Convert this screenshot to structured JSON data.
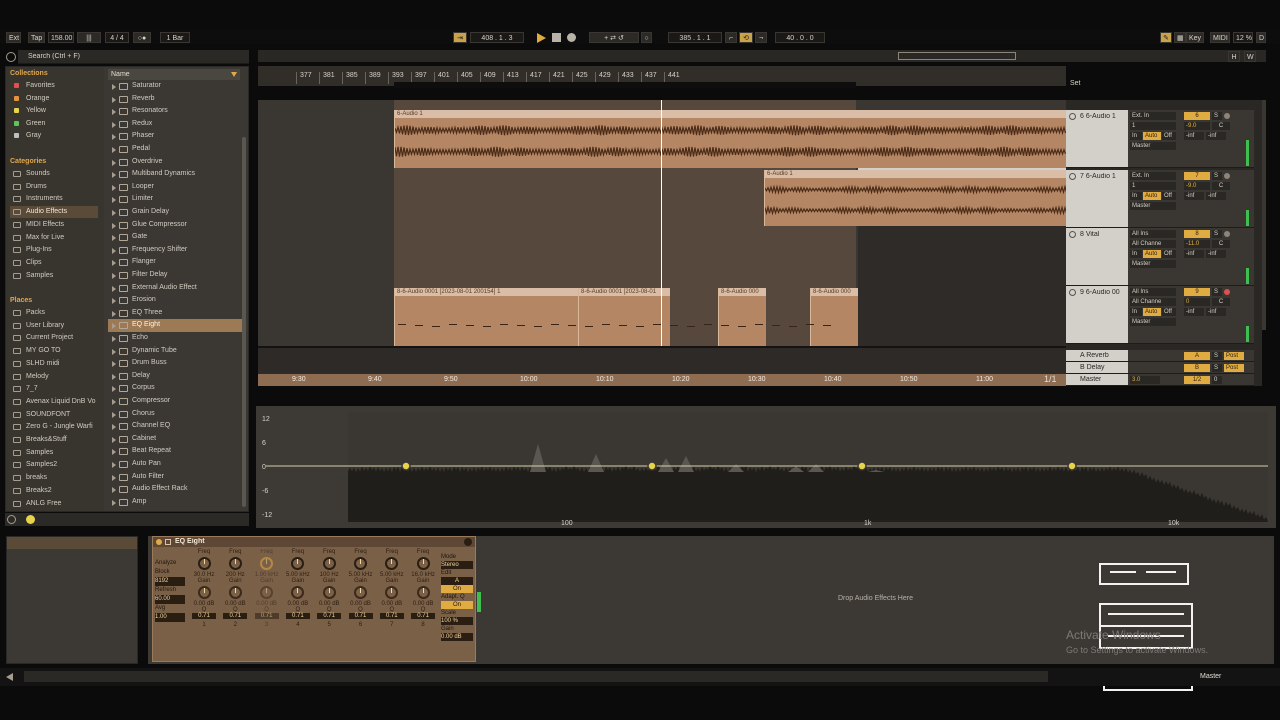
{
  "transport": {
    "ext": "Ext",
    "tap": "Tap",
    "tempo": "158.00",
    "sig": "4 / 4",
    "quant": "1 Bar",
    "pos1": "408 .  1 .  3",
    "pos2": "385 .  1 .  1",
    "len": "40 .  0 .  0",
    "key": "Key",
    "midi": "MIDI",
    "cpu": "12 %",
    "d": "D"
  },
  "browser": {
    "search_placeholder": "Search (Ctrl + F)",
    "collections_title": "Collections",
    "collections": [
      {
        "label": "Favorites",
        "color": "#e05050"
      },
      {
        "label": "Orange",
        "color": "#e8923a"
      },
      {
        "label": "Yellow",
        "color": "#e6d44a"
      },
      {
        "label": "Green",
        "color": "#5cc65c"
      },
      {
        "label": "Gray",
        "color": "#bfbfbf"
      }
    ],
    "categories_title": "Categories",
    "categories": [
      "Sounds",
      "Drums",
      "Instruments",
      "Audio Effects",
      "MIDI Effects",
      "Max for Live",
      "Plug-Ins",
      "Clips",
      "Samples"
    ],
    "places_title": "Places",
    "places": [
      "Packs",
      "User Library",
      "Current Project",
      "MY GO TO",
      "SLHD midi",
      "Melody",
      "7_7",
      "Avenax Liquid DnB Vo",
      "SOUNDFONT",
      "Zero G - Jungle Warfi",
      "Breaks&Stuff",
      "Samples",
      "Samples2",
      "breaks",
      "Breaks2",
      "ANLG Free"
    ],
    "name_header": "Name",
    "items": [
      "Saturator",
      "Reverb",
      "Resonators",
      "Redux",
      "Phaser",
      "Pedal",
      "Overdrive",
      "Multiband Dynamics",
      "Looper",
      "Limiter",
      "Grain Delay",
      "Glue Compressor",
      "Gate",
      "Frequency Shifter",
      "Flanger",
      "Filter Delay",
      "External Audio Effect",
      "Erosion",
      "EQ Three",
      "EQ Eight",
      "Echo",
      "Dynamic Tube",
      "Drum Buss",
      "Delay",
      "Corpus",
      "Compressor",
      "Chorus",
      "Channel EQ",
      "Cabinet",
      "Beat Repeat",
      "Auto Pan",
      "Auto Filter",
      "Audio Effect Rack",
      "Amp"
    ]
  },
  "ruler": {
    "bars": [
      "377",
      "381",
      "385",
      "389",
      "393",
      "397",
      "401",
      "405",
      "409",
      "413",
      "417",
      "421",
      "425",
      "429",
      "433",
      "437",
      "441"
    ],
    "times": [
      "9:30",
      "9:40",
      "9:50",
      "10:00",
      "10:10",
      "10:20",
      "10:30",
      "10:40",
      "10:50",
      "11:00"
    ],
    "set": "Set",
    "page": "1/1"
  },
  "tracks": [
    {
      "name": "6 6-Audio 1",
      "input": "Ext. In",
      "channel": "1",
      "in": "In",
      "auto": "Auto",
      "off": "Off",
      "out": "Master",
      "num": "6",
      "vol": "-9.0",
      "pan": "C",
      "a": "-inf",
      "b": "-inf",
      "s": "S"
    },
    {
      "name": "7 6-Audio 1",
      "input": "Ext. In",
      "channel": "1",
      "in": "In",
      "auto": "Auto",
      "off": "Off",
      "out": "Master",
      "num": "7",
      "vol": "-9.0",
      "pan": "C",
      "a": "-inf",
      "b": "-inf",
      "s": "S"
    },
    {
      "name": "8 Vital",
      "input": "All Ins",
      "channel": "All Channe",
      "in": "In",
      "auto": "Auto",
      "off": "Off",
      "out": "Master",
      "num": "8",
      "vol": "-11.0",
      "pan": "C",
      "a": "-inf",
      "b": "-inf",
      "s": "S"
    },
    {
      "name": "9 6-Audio 00",
      "input": "All Ins",
      "channel": "All Channe",
      "in": "In",
      "auto": "Auto",
      "off": "Off",
      "out": "Master",
      "num": "9",
      "vol": "0",
      "pan": "C",
      "a": "-inf",
      "b": "-inf",
      "s": "S"
    }
  ],
  "returns": [
    {
      "name": "A Reverb",
      "letter": "A",
      "s": "S",
      "post": "Post"
    },
    {
      "name": "B Delay",
      "letter": "B",
      "s": "S",
      "post": "Post"
    },
    {
      "name": "Master",
      "letter": "1/2",
      "vol": "3.0",
      "s": "0"
    }
  ],
  "clips": {
    "c1": "6-Audio 1",
    "c2": "6-Audio 1",
    "c3": "8-6-Audio 0001 [2023-08-01 200154] 1",
    "c4": "8-6-Audio 0001 [2023-08-01",
    "c5": "8-6-Audio 000",
    "c6": "8-6-Audio 000"
  },
  "eq": {
    "db": [
      "12",
      "6",
      "0",
      "-6",
      "-12"
    ],
    "freq": [
      "100",
      "1k",
      "10k"
    ],
    "nodes": [
      150,
      396,
      606,
      816
    ]
  },
  "device": {
    "title": "EQ Eight",
    "analyze": "Analyze",
    "block": "Block",
    "block_val": "8192",
    "refresh": "Refresh",
    "refresh_val": "60.00",
    "avg": "Avg",
    "avg_val": "1.00",
    "bands": [
      {
        "freq": "30.0 Hz",
        "gain": "0.00 dB",
        "q": "0.71",
        "n": "1"
      },
      {
        "freq": "200 Hz",
        "gain": "0.00 dB",
        "q": "0.71",
        "n": "2"
      },
      {
        "freq": "1.00 kHz",
        "gain": "0.00 dB",
        "q": "0.71",
        "n": "3"
      },
      {
        "freq": "5.00 kHz",
        "gain": "0.00 dB",
        "q": "0.71",
        "n": "4"
      },
      {
        "freq": "100 Hz",
        "gain": "0.00 dB",
        "q": "0.71",
        "n": "5"
      },
      {
        "freq": "5.00 kHz",
        "gain": "0.00 dB",
        "q": "0.71",
        "n": "6"
      },
      {
        "freq": "5.00 kHz",
        "gain": "0.00 dB",
        "q": "0.71",
        "n": "7"
      },
      {
        "freq": "16.0 kHz",
        "gain": "0.00 dB",
        "q": "0.71",
        "n": "8"
      }
    ],
    "freq_label": "Freq",
    "gain_label": "Gain",
    "q_label": "Q",
    "mode": "Mode",
    "mode_val": "Stereo",
    "edit": "Edit",
    "edit_val": "A",
    "edit_on": "On",
    "adapt": "Adapt. Q",
    "adapt_val": "On",
    "scale": "Scale",
    "scale_val": "100 %",
    "gain_out": "Gain",
    "gain_out_val": "0.00 dB"
  },
  "drop_text": "Drop Audio Effects Here",
  "watermark": {
    "line1": "Activate Windows",
    "line2": "Go to Settings to activate Windows."
  },
  "status": {
    "master": "Master"
  }
}
